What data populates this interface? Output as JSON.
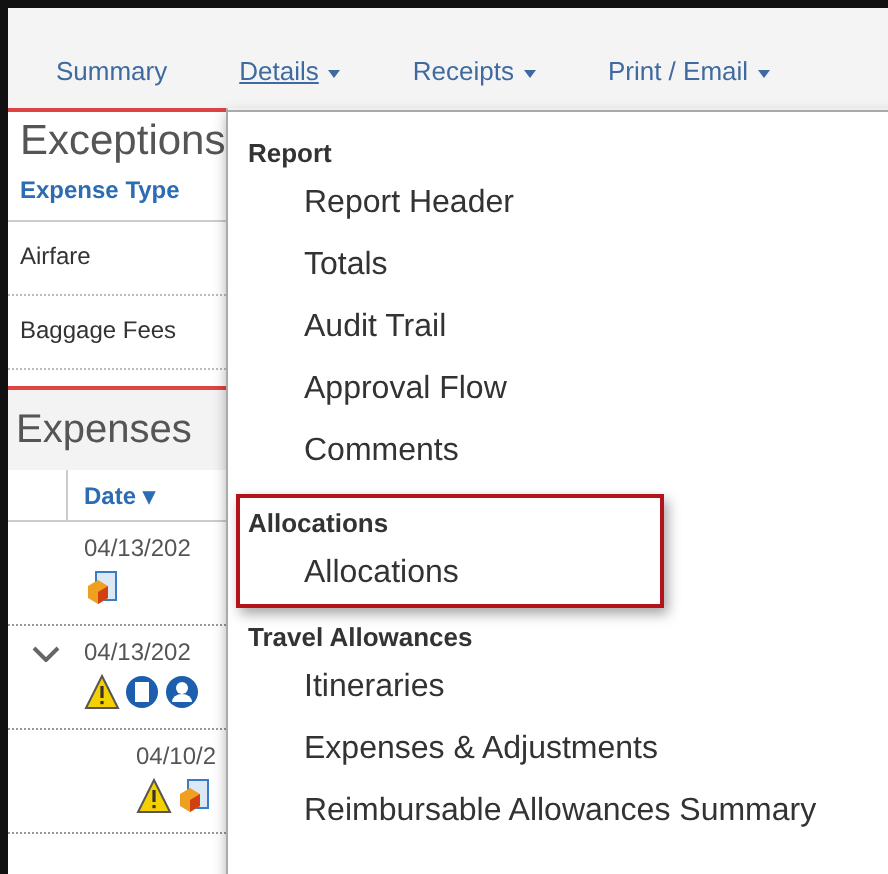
{
  "nav_tabs": [
    {
      "label": "Summary",
      "dropdown": false,
      "selected": false
    },
    {
      "label": "Details",
      "dropdown": true,
      "selected": true
    },
    {
      "label": "Receipts",
      "dropdown": true,
      "selected": false
    },
    {
      "label": "Print / Email",
      "dropdown": true,
      "selected": false
    }
  ],
  "exceptions": {
    "title": "Exceptions",
    "column": "Expense Type",
    "rows": [
      "Airfare",
      "Baggage Fees"
    ]
  },
  "expenses": {
    "title": "Expenses",
    "column": "Date",
    "sort_mark": "▾",
    "rows": [
      {
        "date": "04/13/202",
        "expandable": false,
        "indented": false,
        "icons": [
          {
            "kind": "receipt"
          }
        ]
      },
      {
        "date": "04/13/202",
        "expandable": true,
        "indented": false,
        "icons": [
          {
            "kind": "warning"
          },
          {
            "kind": "document"
          },
          {
            "kind": "person"
          }
        ]
      },
      {
        "date": "04/10/2",
        "expandable": false,
        "indented": true,
        "icons": [
          {
            "kind": "warning"
          },
          {
            "kind": "receipt"
          }
        ]
      }
    ]
  },
  "details_menu": {
    "groups": [
      {
        "heading": "Report",
        "highlighted": false,
        "items": [
          "Report Header",
          "Totals",
          "Audit Trail",
          "Approval Flow",
          "Comments"
        ]
      },
      {
        "heading": "Allocations",
        "highlighted": true,
        "items": [
          "Allocations"
        ]
      },
      {
        "heading": "Travel Allowances",
        "highlighted": false,
        "items": [
          "Itineraries",
          "Expenses & Adjustments",
          "Reimbursable Allowances Summary"
        ]
      }
    ]
  }
}
